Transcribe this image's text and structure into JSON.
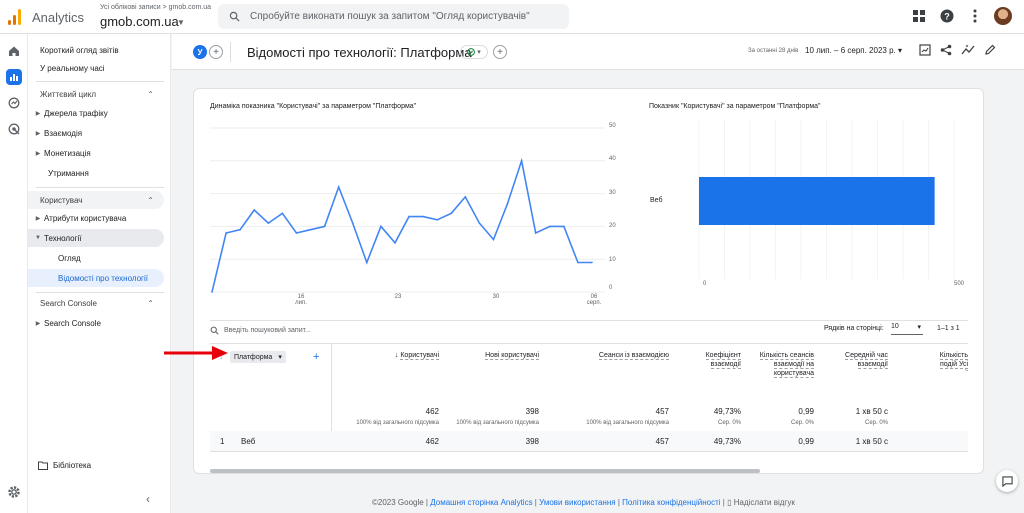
{
  "app": {
    "name": "Analytics",
    "account_path": "Усі облікові записи > gmob.com.ua",
    "property": "gmob.com.ua"
  },
  "search": {
    "placeholder": "Спробуйте виконати пошук за запитом \"Огляд користувачів\""
  },
  "colors": {
    "accent": "#1a73e8",
    "line": "#4285f4",
    "bar": "#1a73e8",
    "arrow": "#e8000b",
    "logo": [
      "#f9ab00",
      "#e37400",
      "#e37400"
    ]
  },
  "nav": {
    "overview": "Короткий огляд звітів",
    "realtime": "У реальному часі",
    "lifecycle": "Життєвий цикл",
    "lifecycle_items": [
      "Джерела трафіку",
      "Взаємодія",
      "Монетизація"
    ],
    "retention": "Утримання",
    "user": "Користувач",
    "user_attrs": "Атрибути користувача",
    "tech": "Технології",
    "tech_overview": "Огляд",
    "tech_details": "Відомості про технології",
    "search_console_section": "Search Console",
    "search_console_item": "Search Console",
    "library": "Бібліотека"
  },
  "header": {
    "badge": "У",
    "title": "Відомості про технології: Платформа",
    "date_label": "За останні 28 днів",
    "date_range": "10 лип. – 6 серп. 2023 р."
  },
  "line_chart": {
    "title": "Динаміка показника \"Користувачі\" за параметром \"Платформа\"",
    "y_ticks": [
      "50",
      "40",
      "30",
      "20",
      "10",
      "0"
    ],
    "x_ticks": [
      {
        "d": "16",
        "m": "лип."
      },
      {
        "d": "23",
        "m": ""
      },
      {
        "d": "30",
        "m": ""
      },
      {
        "d": "06",
        "m": "серп."
      }
    ]
  },
  "bar_chart": {
    "title": "Показник \"Користувачі\" за параметром \"Платформа\"",
    "category": "Веб",
    "x_ticks": [
      "0",
      "500"
    ]
  },
  "chart_data": [
    {
      "type": "line",
      "title": "Динаміка показника \"Користувачі\" за параметром \"Платформа\"",
      "x": [
        "10 лип.",
        "11 лип.",
        "12 лип.",
        "13 лип.",
        "14 лип.",
        "15 лип.",
        "16 лип.",
        "17 лип.",
        "18 лип.",
        "19 лип.",
        "20 лип.",
        "21 лип.",
        "22 лип.",
        "23 лип.",
        "24 лип.",
        "25 лип.",
        "26 лип.",
        "27 лип.",
        "28 лип.",
        "29 лип.",
        "30 лип.",
        "31 лип.",
        "1 серп.",
        "2 серп.",
        "3 серп.",
        "4 серп.",
        "5 серп.",
        "6 серп."
      ],
      "values": [
        0,
        18,
        19,
        25,
        21,
        24,
        18,
        19,
        20,
        32,
        21,
        9,
        20,
        15,
        23,
        23,
        22,
        24,
        29,
        21,
        16,
        27,
        40,
        18,
        20,
        20,
        9,
        9
      ],
      "ylim": [
        0,
        50
      ]
    },
    {
      "type": "bar",
      "title": "Показник \"Користувачі\" за параметром \"Платформа\"",
      "categories": [
        "Веб"
      ],
      "values": [
        462
      ],
      "xlim": [
        0,
        500
      ]
    }
  ],
  "table": {
    "search_placeholder": "Введіть пошуковий запит...",
    "rows_per_page_label": "Рядків на сторінці:",
    "rows_per_page": "10",
    "range": "1–1 з 1",
    "dimension": "Платформа",
    "columns": [
      "Користувачі",
      "Нові користувачі",
      "Сеанси із взаємодією",
      "Коефіцієнт взаємодії",
      "Кількість сеансів взаємодії на користувача",
      "Середній час взаємодії",
      "Кількість подій Усі події"
    ],
    "totals": [
      "462",
      "398",
      "457",
      "49,73%",
      "0,99",
      "1 хв 50 с"
    ],
    "totals_sub": [
      "100% від загального підсумка",
      "100% від загального підсумка",
      "100% від загального підсумка",
      "Сер. 0%",
      "Сер. 0%",
      "Сер. 0%"
    ],
    "row": {
      "index": "1",
      "platform": "Веб",
      "values": [
        "462",
        "398",
        "457",
        "49,73%",
        "0,99",
        "1 хв 50 с"
      ]
    }
  },
  "footer": {
    "copyright": "©2023 Google |",
    "links": [
      "Домашня сторінка Analytics",
      "Умови використання",
      "Політика конфіденційності"
    ],
    "feedback": "Надіслати відгук"
  }
}
